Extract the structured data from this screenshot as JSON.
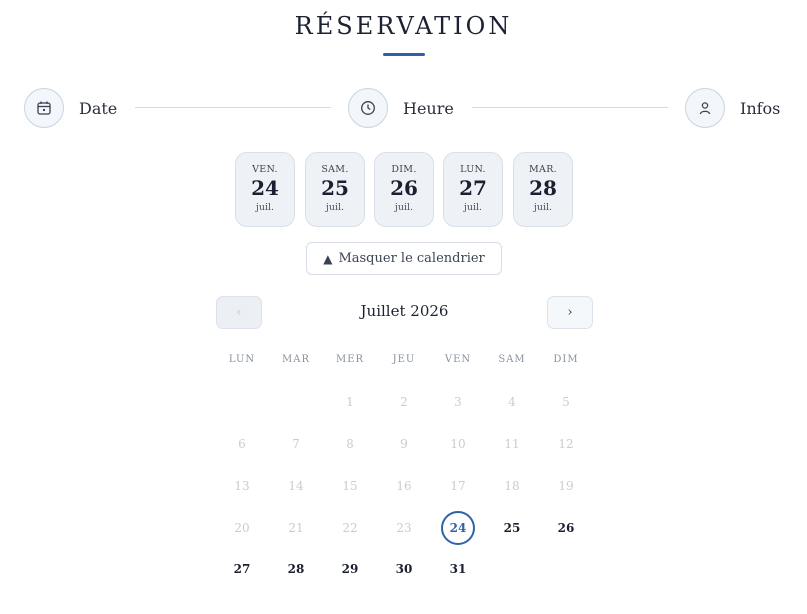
{
  "title": "RÉSERVATION",
  "steps": [
    {
      "label": "Date",
      "icon": "calendar-icon"
    },
    {
      "label": "Heure",
      "icon": "clock-icon"
    },
    {
      "label": "Infos",
      "icon": "user-icon"
    }
  ],
  "day_chips": [
    {
      "weekday": "VEN.",
      "day": "24",
      "month": "juil."
    },
    {
      "weekday": "SAM.",
      "day": "25",
      "month": "juil."
    },
    {
      "weekday": "DIM.",
      "day": "26",
      "month": "juil."
    },
    {
      "weekday": "LUN.",
      "day": "27",
      "month": "juil."
    },
    {
      "weekday": "MAR.",
      "day": "28",
      "month": "juil."
    }
  ],
  "toggle_calendar": {
    "icon": "▲",
    "label": "Masquer le calendrier"
  },
  "calendar": {
    "prev_label": "‹",
    "next_label": "›",
    "month_label": "Juillet 2026",
    "weekdays": [
      "LUN",
      "MAR",
      "MER",
      "JEU",
      "VEN",
      "SAM",
      "DIM"
    ],
    "days": [
      {
        "n": "1",
        "state": "disabled"
      },
      {
        "n": "2",
        "state": "disabled"
      },
      {
        "n": "3",
        "state": "disabled"
      },
      {
        "n": "4",
        "state": "disabled"
      },
      {
        "n": "5",
        "state": "disabled"
      },
      {
        "n": "6",
        "state": "disabled"
      },
      {
        "n": "7",
        "state": "disabled"
      },
      {
        "n": "8",
        "state": "disabled"
      },
      {
        "n": "9",
        "state": "disabled"
      },
      {
        "n": "10",
        "state": "disabled"
      },
      {
        "n": "11",
        "state": "disabled"
      },
      {
        "n": "12",
        "state": "disabled"
      },
      {
        "n": "13",
        "state": "disabled"
      },
      {
        "n": "14",
        "state": "disabled"
      },
      {
        "n": "15",
        "state": "disabled"
      },
      {
        "n": "16",
        "state": "disabled"
      },
      {
        "n": "17",
        "state": "disabled"
      },
      {
        "n": "18",
        "state": "disabled"
      },
      {
        "n": "19",
        "state": "disabled"
      },
      {
        "n": "20",
        "state": "disabled"
      },
      {
        "n": "21",
        "state": "disabled"
      },
      {
        "n": "22",
        "state": "disabled"
      },
      {
        "n": "23",
        "state": "disabled"
      },
      {
        "n": "24",
        "state": "selected"
      },
      {
        "n": "25",
        "state": "available"
      },
      {
        "n": "26",
        "state": "available"
      },
      {
        "n": "27",
        "state": "available"
      },
      {
        "n": "28",
        "state": "available"
      },
      {
        "n": "29",
        "state": "available"
      },
      {
        "n": "30",
        "state": "available"
      },
      {
        "n": "31",
        "state": "available"
      }
    ]
  },
  "colors": {
    "accent": "#2f5fa8",
    "chip_bg": "#eef2f7",
    "disabled_text": "#c8cdd4"
  }
}
